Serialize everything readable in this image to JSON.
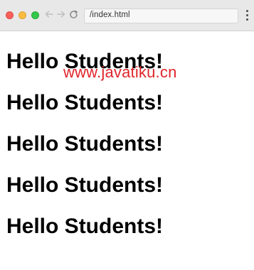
{
  "browser": {
    "address_url": "/index.html",
    "icons": {
      "back": "arrow-left-icon",
      "forward": "arrow-right-icon",
      "reload": "reload-icon",
      "menu": "more-vertical-icon"
    },
    "traffic_light_colors": [
      "#fc605b",
      "#fdbc40",
      "#34c84a"
    ]
  },
  "page": {
    "headings": [
      "Hello Students!",
      "Hello Students!",
      "Hello Students!",
      "Hello Students!",
      "Hello Students!"
    ],
    "watermark": "www.javatiku.cn",
    "watermark_color": "#e0252b"
  }
}
